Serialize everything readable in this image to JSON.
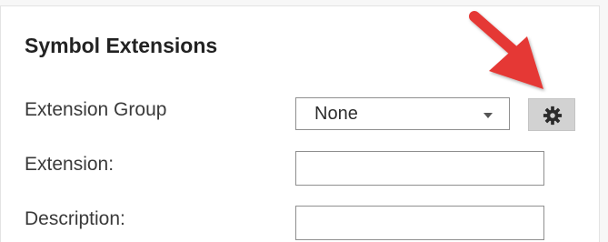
{
  "section": {
    "title": "Symbol Extensions"
  },
  "fields": {
    "extension_group": {
      "label": "Extension Group",
      "selected": "None"
    },
    "extension": {
      "label": "Extension:",
      "value": ""
    },
    "description": {
      "label": "Description:",
      "value": ""
    }
  },
  "icons": {
    "settings_button": "gear-icon",
    "dropdown": "chevron-down-icon",
    "annotation": "arrow-pointer"
  },
  "colors": {
    "annotation_arrow": "#e53935",
    "settings_button_bg": "#d2d2d2",
    "input_border": "#8f8f8f",
    "title_text": "#222222",
    "label_text": "#3a3a3a"
  }
}
